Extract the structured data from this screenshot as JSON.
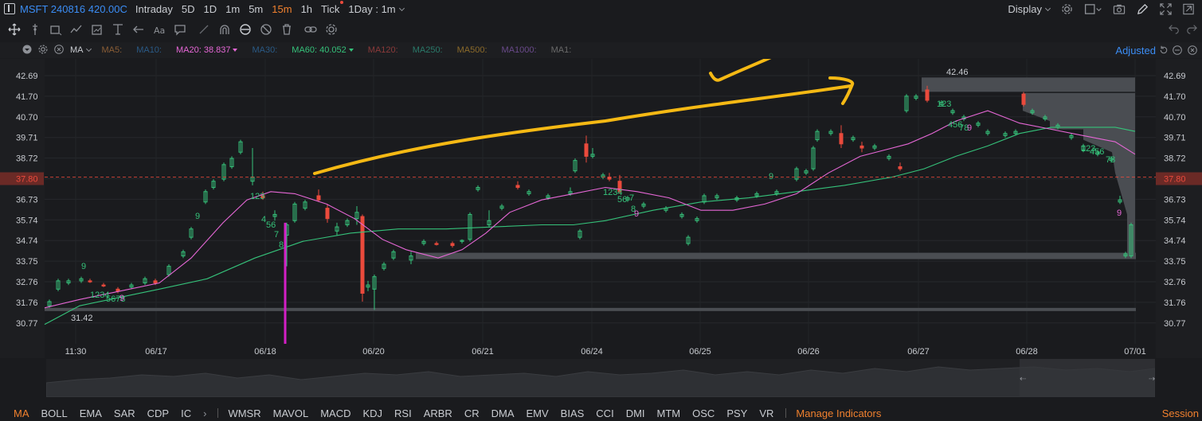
{
  "topbar": {
    "symbol": "MSFT 240816 420.00C",
    "timeframes": [
      "Intraday",
      "5D",
      "1D",
      "1m",
      "5m",
      "15m",
      "1h",
      "Tick"
    ],
    "active_timeframe": "15m",
    "period_select": "1Day : 1m",
    "display_label": "Display"
  },
  "indicator_row": {
    "name": "MA",
    "items": [
      {
        "label": "MA5:",
        "value": "",
        "color": "#8b5e36"
      },
      {
        "label": "MA10:",
        "value": "",
        "color": "#2a5a86"
      },
      {
        "label": "MA20:",
        "value": "38.837",
        "color": "#e667d6"
      },
      {
        "label": "MA30:",
        "value": "",
        "color": "#2a5a86"
      },
      {
        "label": "MA60:",
        "value": "40.052",
        "color": "#35c27a"
      },
      {
        "label": "MA120:",
        "value": "",
        "color": "#8b3a3a"
      },
      {
        "label": "MA250:",
        "value": "",
        "color": "#2a7a6a"
      },
      {
        "label": "MA500:",
        "value": "",
        "color": "#8b6a2a"
      },
      {
        "label": "MA1000:",
        "value": "",
        "color": "#6a4a8b"
      },
      {
        "label": "MA1:",
        "value": "",
        "color": "#6a6a6a"
      }
    ],
    "adjusted_label": "Adjusted"
  },
  "chart": {
    "y_ticks": [
      "42.69",
      "41.70",
      "40.70",
      "39.71",
      "38.72",
      "37.80",
      "36.73",
      "35.74",
      "34.74",
      "33.75",
      "32.76",
      "31.76",
      "30.77"
    ],
    "current_price": "37.80",
    "x_ticks": [
      "11:30",
      "06/17",
      "06/18",
      "06/20",
      "06/21",
      "06/24",
      "06/25",
      "06/26",
      "06/27",
      "06/28",
      "07/01"
    ],
    "high_label": "42.46",
    "low_label": "31.42",
    "up_color": "#35c27a",
    "down_color": "#ea4a3c",
    "ma20_color": "#e667d6",
    "ma60_color": "#35c27a",
    "annotation_color": "#f5b914"
  },
  "bottom_tabs": {
    "tabs": [
      "MA",
      "BOLL",
      "EMA",
      "SAR",
      "CDP",
      "IC"
    ],
    "tabs2": [
      "WMSR",
      "MAVOL",
      "MACD",
      "KDJ",
      "RSI",
      "ARBR",
      "CR",
      "DMA",
      "EMV",
      "BIAS",
      "CCI",
      "DMI",
      "MTM",
      "OSC",
      "PSY",
      "VR"
    ],
    "active": "MA",
    "manage": "Manage Indicators",
    "session": "Session"
  }
}
